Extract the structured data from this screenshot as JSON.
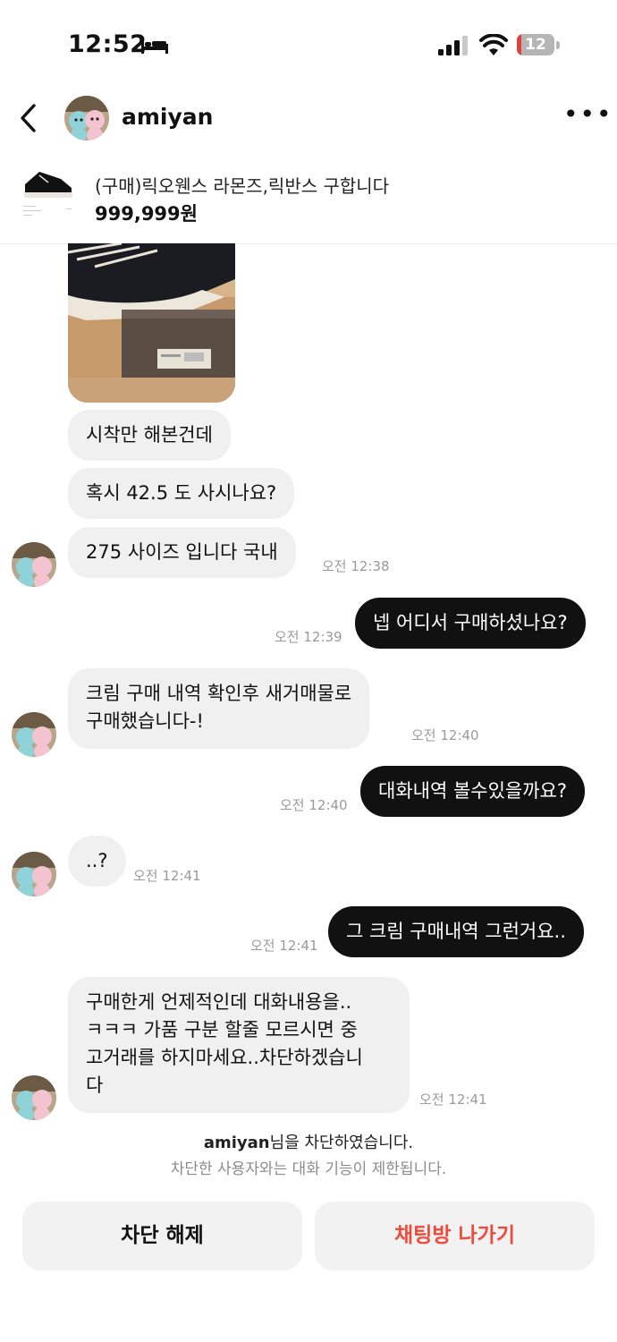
{
  "status_bar": {
    "time": "12:52",
    "battery_level": "12",
    "focus_icon": "bed-icon",
    "icons": [
      "signal-icon",
      "wifi-icon",
      "battery-icon"
    ]
  },
  "header": {
    "username": "amiyan",
    "back_icon": "chevron-left-icon",
    "more_icon": "more-horizontal-icon"
  },
  "product": {
    "title": "(구매)릭오웬스 라몬즈,릭반스 구합니다",
    "price": "999,999원"
  },
  "messages": [
    {
      "side": "in",
      "text": "시착만 해본건데",
      "time": ""
    },
    {
      "side": "in",
      "text": "혹시 42.5 도 사시나요?",
      "time": ""
    },
    {
      "side": "in",
      "text": "275 사이즈 입니다 국내",
      "time": "오전 12:38"
    },
    {
      "side": "out",
      "text": "넵 어디서 구매하셨나요?",
      "time": "오전 12:39"
    },
    {
      "side": "in",
      "text": "크림 구매 내역 확인후 새거매물로\n구매했습니다-!",
      "time": "오전 12:40"
    },
    {
      "side": "out",
      "text": "대화내역 볼수있을까요?",
      "time": "오전 12:40"
    },
    {
      "side": "in",
      "text": "..?",
      "time": "오전 12:41"
    },
    {
      "side": "out",
      "text": "그 크림 구매내역 그런거요..",
      "time": "오전 12:41"
    },
    {
      "side": "in",
      "text": "구매한게 언제적인데 대화내용을..\nㅋㅋㅋ 가품 구분 할줄 모르시면 중\n고거래를 하지마세요..차단하겠습니\n다",
      "time": "오전 12:41"
    }
  ],
  "notice": {
    "blocked_user": "amiyan",
    "blocked_suffix": "님을 차단하였습니다.",
    "restriction": "차단한 사용자와는 대화 기능이 제한됩니다."
  },
  "actions": {
    "unblock_label": "차단 해제",
    "leave_label": "채팅방 나가기"
  },
  "colors": {
    "incoming_bubble": "#f0f0f0",
    "outgoing_bubble": "#111111",
    "leave_button_text": "#ee4b3c",
    "battery_low": "#e0403a"
  }
}
